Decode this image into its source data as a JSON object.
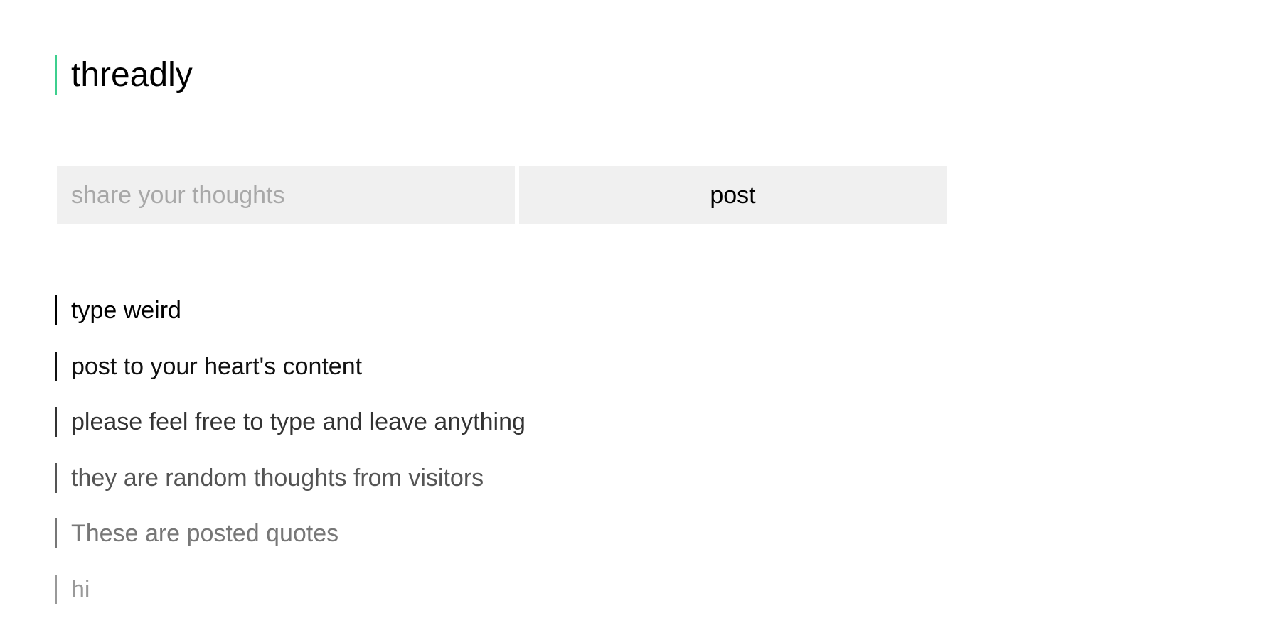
{
  "brand": {
    "title": "threadly",
    "accent_color": "#3ecf8e"
  },
  "composer": {
    "placeholder": "share your thoughts",
    "value": "",
    "post_label": "post"
  },
  "posts": [
    {
      "text": "type weird",
      "color": "#000000"
    },
    {
      "text": "post to your heart's content",
      "color": "#111111"
    },
    {
      "text": "please feel free to type and leave anything",
      "color": "#333333"
    },
    {
      "text": "they are random thoughts from visitors",
      "color": "#555555"
    },
    {
      "text": "These are posted quotes",
      "color": "#777777"
    },
    {
      "text": "hi",
      "color": "#999999"
    }
  ]
}
